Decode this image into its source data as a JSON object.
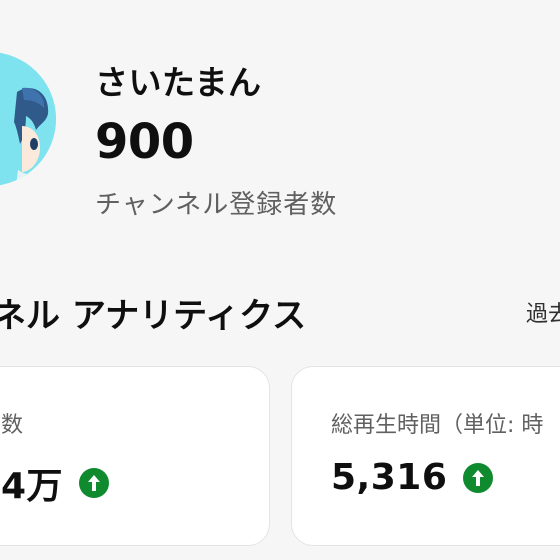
{
  "channel": {
    "name": "さいたまん",
    "subscriber_count": "900",
    "subscriber_label": "チャンネル登録者数"
  },
  "analytics": {
    "title": "ネル アナリティクス",
    "period_label": "過去",
    "cards": [
      {
        "label": "数",
        "value": "4万",
        "trend": "up",
        "trend_icon": "arrow-up-icon"
      },
      {
        "label": "総再生時間（単位: 時",
        "value": "5,316",
        "trend": "up",
        "trend_icon": "arrow-up-icon"
      }
    ]
  },
  "colors": {
    "background": "#f6f6f6",
    "card_background": "#ffffff",
    "trend_up": "#0f8a2f",
    "secondary_text": "#606060",
    "avatar_background": "#7fe3ef"
  }
}
